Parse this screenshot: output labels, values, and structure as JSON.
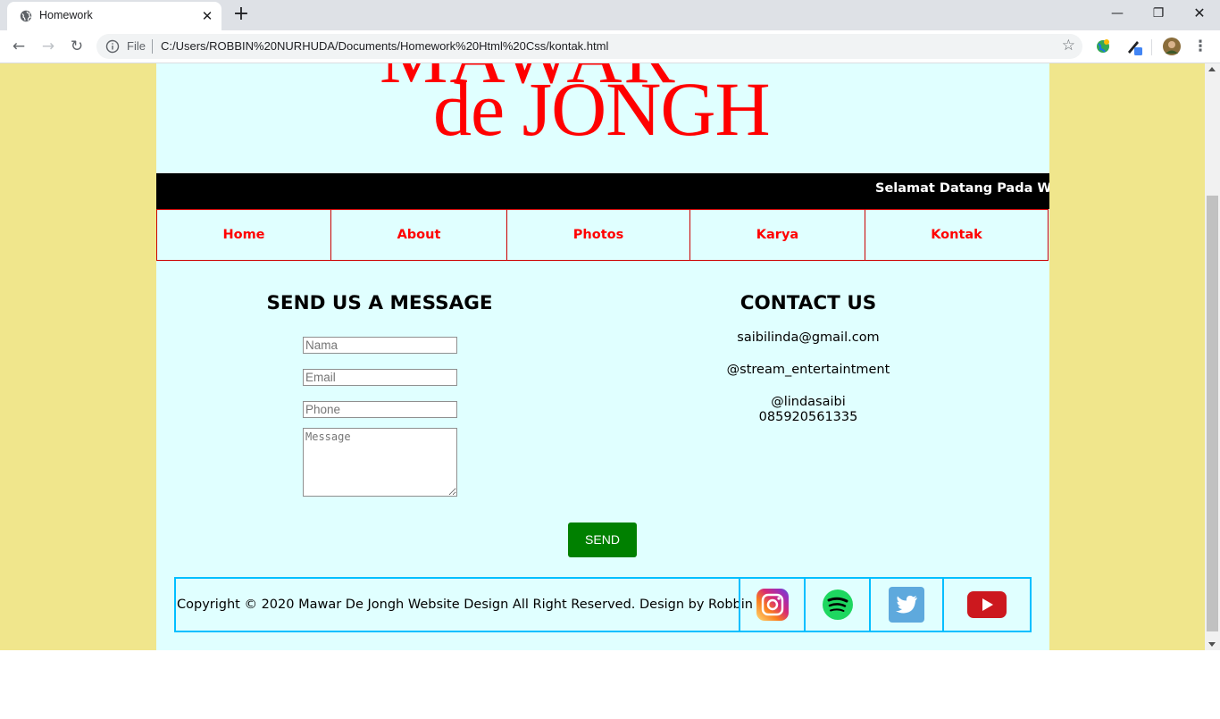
{
  "browser": {
    "tab_title": "Homework",
    "url_scheme": "File",
    "url": "C:/Users/ROBBIN%20NURHUDA/Documents/Homework%20Html%20Css/kontak.html"
  },
  "site": {
    "logo_text_bottom": "de JONGH",
    "logo_text_top": "MAWAR",
    "marquee_text": "Selamat Datang Pada W",
    "nav": [
      "Home",
      "About",
      "Photos",
      "Karya",
      "Kontak"
    ],
    "form": {
      "title": "SEND US A MESSAGE",
      "name_placeholder": "Nama",
      "email_placeholder": "Email",
      "phone_placeholder": "Phone",
      "message_placeholder": "Message",
      "send_label": "SEND"
    },
    "contact": {
      "title": "CONTACT US",
      "email": "saibilinda@gmail.com",
      "social_handle": "@stream_entertaintment",
      "instagram": "@lindasaibi",
      "phone": "085920561335"
    },
    "footer": {
      "copyright": "Copyright © 2020 Mawar De Jongh Website Design All Right Reserved. Design by Robbin",
      "social_icons": [
        "instagram-icon",
        "spotify-icon",
        "twitter-icon",
        "youtube-icon"
      ]
    },
    "colors": {
      "page_bg": "#f0e68c",
      "content_bg": "#e0ffff",
      "accent_red": "#ff0000",
      "send_button": "#008000",
      "footer_border": "#00bfff"
    }
  }
}
